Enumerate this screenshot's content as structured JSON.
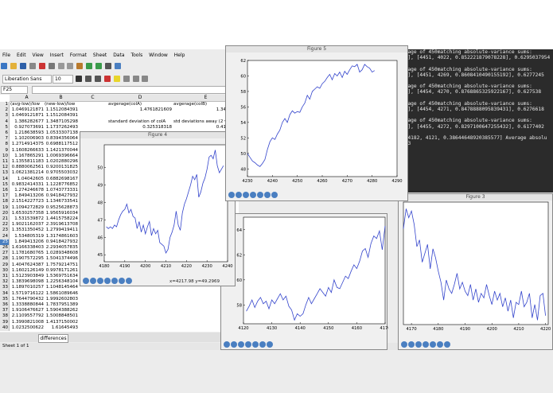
{
  "menu": [
    "File",
    "Edit",
    "View",
    "Insert",
    "Format",
    "Sheet",
    "Data",
    "Tools",
    "Window",
    "Help"
  ],
  "font": {
    "name": "Liberation Sans",
    "size": "10"
  },
  "namebox": "F25",
  "columns": [
    "A",
    "B",
    "C",
    "D",
    "E"
  ],
  "headers": {
    "a": "(avg-low)/low",
    "b": "(new-low)/low",
    "d": "avgerage(colA)",
    "e": "avgerage(colB)"
  },
  "stats": {
    "avgA": "1.4761821609",
    "avgB": "1.341899",
    "sd_label": "standard deviation of colA",
    "sd_away_label": "std deviations away (2 va",
    "sd_value": "0.325318318",
    "sd_away_value": "0.412772"
  },
  "rows": [
    [
      "1.0469121871",
      "1.1512084391"
    ],
    [
      "1.0469121871",
      "1.1512084391"
    ],
    [
      "1.386282677",
      "1.3487105298"
    ],
    [
      "0.927073691",
      "1.1737262493"
    ],
    [
      "1.218638593",
      "1.0533307138"
    ],
    [
      "1.102006903",
      "0.8394356064"
    ],
    [
      "1.2714914375",
      "0.6988117512"
    ],
    [
      "1.1608266633",
      "1.1421370044"
    ],
    [
      "1.167865291",
      "1.0069396664"
    ],
    [
      "1.1355811183",
      "1.0202880296"
    ],
    [
      "0.8880062561",
      "0.9200131825"
    ],
    [
      "1.0621381214",
      "0.9705503032"
    ],
    [
      "1.04042605",
      "0.6882698167"
    ],
    [
      "0.9832414331",
      "1.1228776852"
    ],
    [
      "1.274246678",
      "1.0743773331"
    ],
    [
      "1.849413206",
      "0.9418427932"
    ],
    [
      "2.1514227723",
      "1.1346733541"
    ],
    [
      "1.1094272829",
      "0.9525628873"
    ],
    [
      "1.6530257358",
      "1.9565916034"
    ],
    [
      "1.531539872",
      "1.4415758224"
    ],
    [
      "1.9021162037",
      "2.3919613708"
    ],
    [
      "1.3531350452",
      "1.2799419411"
    ],
    [
      "1.534805319",
      "1.3174861603"
    ],
    [
      "1.849413206",
      "0.9418427932"
    ],
    [
      "1.6166338403",
      "2.2934057835"
    ],
    [
      "1.1781680765",
      "1.0289348608"
    ],
    [
      "1.1907572295",
      "1.5041374496"
    ],
    [
      "1.4047624387",
      "1.7579214751"
    ],
    [
      "1.1602126149",
      "0.9978171261"
    ],
    [
      "1.5123903849",
      "1.5369751634"
    ],
    [
      "1.3839698098",
      "1.2256348104"
    ],
    [
      "1.1897010257",
      "1.1048145464"
    ],
    [
      "1.5719716122",
      "1.5861089646"
    ],
    [
      "1.7644790432",
      "1.9992602803"
    ],
    [
      "1.3338880844",
      "1.7837951389"
    ],
    [
      "1.9106476627",
      "1.5904388262"
    ],
    [
      "2.1109557792",
      "1.5008848501"
    ],
    [
      "1.3990821008",
      "1.4137150002"
    ],
    [
      "1.0232500622",
      "1.61645493"
    ]
  ],
  "sheet": {
    "tab": "differences",
    "status": "Sheet 1 of 1"
  },
  "terminal": [
    "erage of 450matching absolute-variance sums:",
    "46], [4451, 4022, 0.852221879078228], 0.6295037954",
    "",
    "erage of 450matching absolute-variance sums:",
    "73], [4451, 4269, 0.8608410490155192], 0.6277245",
    "",
    "erage of 450matching absolute-variance sums:",
    "73], [4454, 4270, 0.8768865325922167], 0.627538",
    "",
    "erage of 450matching absolute-variance sums:",
    "57], [4454, 4271, 0.8478888095839431], 0.6276618",
    "",
    "erage of 450matching absolute-variance sums:",
    "38], [4455, 4272, 0.8297100647255432], 0.6177402",
    "",
    " [4182, 4121, 0.38644648920385577] Average absolu",
    "863"
  ],
  "fig5": {
    "title": "Figure 5",
    "xticks": [
      "4230",
      "4240",
      "4250",
      "4260",
      "4270",
      "4280",
      "4290"
    ],
    "yticks": [
      "62",
      "60",
      "58",
      "56",
      "54",
      "52",
      "50",
      "48"
    ]
  },
  "figmid": {
    "title": "Figure 4",
    "xticks": [
      "4180",
      "4190",
      "4200",
      "4210",
      "4220",
      "4230",
      "4240"
    ],
    "yticks": [
      "50",
      "49",
      "48",
      "47",
      "46",
      "45"
    ],
    "coords": "x=4217.98    y=49.2969"
  },
  "figbl": {
    "xticks": [
      "4120",
      "4130",
      "4140",
      "4150",
      "4160",
      "4170"
    ],
    "yticks": [
      "64",
      "62",
      "60",
      "58"
    ]
  },
  "figbr": {
    "title": "Figure 3",
    "xticks": [
      "4170",
      "4180",
      "4190",
      "4200",
      "4210",
      "4220"
    ]
  },
  "chart_data": [
    {
      "type": "line",
      "title": "Figure 5",
      "xlim": [
        4230,
        4290
      ],
      "ylim": [
        47,
        62
      ],
      "x": [
        4230,
        4231,
        4232,
        4233,
        4234,
        4235,
        4236,
        4237,
        4238,
        4239,
        4240,
        4241,
        4242,
        4243,
        4244,
        4245,
        4246,
        4247,
        4248,
        4249,
        4250,
        4251,
        4252,
        4253,
        4254,
        4255,
        4256,
        4257,
        4258,
        4259,
        4260,
        4261,
        4262,
        4263,
        4264,
        4265,
        4266,
        4267,
        4268,
        4269,
        4270,
        4271,
        4272,
        4273,
        4274,
        4275,
        4276,
        4277,
        4278,
        4279,
        4280,
        4281
      ],
      "y": [
        50,
        49.5,
        49,
        48.8,
        48.5,
        48.3,
        48.7,
        49.2,
        50.5,
        51.5,
        52,
        51.8,
        52.5,
        53,
        54,
        54.5,
        54,
        55,
        55.5,
        55.2,
        55.4,
        55.3,
        56,
        56.5,
        57.5,
        57,
        58,
        58.3,
        58.6,
        58.4,
        59,
        59.3,
        59.8,
        60.2,
        59.5,
        60.3,
        60,
        60.5,
        59.8,
        60.6,
        60.2,
        60.8,
        61.3,
        61.2,
        61.5,
        60.5,
        60.8,
        61.5,
        61.2,
        61,
        60.5,
        60.7
      ]
    },
    {
      "type": "line",
      "title": "Figure 4",
      "xlim": [
        4180,
        4240
      ],
      "ylim": [
        44.6,
        51.3
      ],
      "x": [
        4181,
        4182,
        4183,
        4184,
        4185,
        4186,
        4187,
        4188,
        4189,
        4190,
        4191,
        4192,
        4193,
        4194,
        4195,
        4196,
        4197,
        4198,
        4199,
        4200,
        4201,
        4202,
        4203,
        4204,
        4205,
        4206,
        4207,
        4208,
        4209,
        4210,
        4211,
        4212,
        4213,
        4214,
        4215,
        4216,
        4217,
        4218,
        4219,
        4220,
        4221,
        4222,
        4223,
        4224,
        4225,
        4226,
        4227,
        4228,
        4229,
        4230,
        4231,
        4232,
        4233,
        4234,
        4235,
        4236,
        4237,
        4238
      ],
      "y": [
        46.6,
        46.5,
        46.6,
        46.5,
        46.7,
        46.6,
        47,
        47.3,
        47.5,
        47.6,
        47.9,
        47.4,
        47.6,
        47.2,
        47.1,
        46.5,
        46.9,
        46.3,
        46.7,
        46.2,
        46.6,
        46.9,
        46.1,
        46.5,
        46.2,
        46.4,
        45.7,
        45.6,
        45.5,
        45.1,
        45.3,
        46,
        46.3,
        46.7,
        47.5,
        46.7,
        46.4,
        47.4,
        47.9,
        48.2,
        48.6,
        49,
        49.5,
        49.3,
        49.6,
        48.3,
        48.6,
        49.1,
        49.4,
        49.9,
        50.6,
        50.7,
        50.5,
        51,
        50.1,
        49.7,
        49.9,
        50.1
      ]
    },
    {
      "type": "line",
      "xlim": [
        4120,
        4170
      ],
      "ylim": [
        56.5,
        65
      ],
      "x": [
        4121,
        4122,
        4123,
        4124,
        4125,
        4126,
        4127,
        4128,
        4129,
        4130,
        4131,
        4132,
        4133,
        4134,
        4135,
        4136,
        4137,
        4138,
        4139,
        4140,
        4141,
        4142,
        4143,
        4144,
        4145,
        4146,
        4147,
        4148,
        4149,
        4150,
        4151,
        4152,
        4153,
        4154,
        4155,
        4156,
        4157,
        4158,
        4159,
        4160,
        4161,
        4162,
        4163,
        4164,
        4165,
        4166,
        4167,
        4168,
        4169,
        4170
      ],
      "y": [
        57.5,
        57.9,
        58.4,
        57.8,
        58.3,
        58.6,
        58.1,
        58.3,
        57.7,
        58.4,
        58.1,
        58.5,
        58.9,
        58.4,
        58.7,
        57.9,
        57.6,
        56.8,
        57.3,
        57.1,
        57.3,
        58,
        58.6,
        58.1,
        58.5,
        58.9,
        59.3,
        59,
        58.7,
        59.4,
        59,
        60,
        59.4,
        59.3,
        59.8,
        60.3,
        60.1,
        60.7,
        61.2,
        60.9,
        61.5,
        62.3,
        62.5,
        61.8,
        62.9,
        63.5,
        63.3,
        63.9,
        62.4,
        64.3
      ]
    },
    {
      "type": "line",
      "title": "Figure 3",
      "xlim": [
        4167,
        4221
      ],
      "ylim": [
        61,
        66.5
      ],
      "x": [
        4167,
        4168,
        4169,
        4170,
        4171,
        4172,
        4173,
        4174,
        4175,
        4176,
        4177,
        4178,
        4179,
        4180,
        4181,
        4182,
        4183,
        4184,
        4185,
        4186,
        4187,
        4188,
        4189,
        4190,
        4191,
        4192,
        4193,
        4194,
        4195,
        4196,
        4197,
        4198,
        4199,
        4200,
        4201,
        4202,
        4203,
        4204,
        4205,
        4206,
        4207,
        4208,
        4209,
        4210,
        4211,
        4212,
        4213,
        4214,
        4215,
        4216,
        4217,
        4218,
        4219,
        4220
      ],
      "y": [
        65.3,
        66.2,
        65.8,
        66.1,
        65.5,
        64.5,
        64.8,
        63.8,
        64.2,
        64.6,
        63.5,
        64.4,
        64,
        63.4,
        62.9,
        62.1,
        63,
        62.6,
        62.4,
        62.8,
        63.3,
        62.6,
        62.9,
        62.5,
        62.3,
        62.8,
        62.1,
        62.6,
        62,
        62.4,
        62.2,
        62.8,
        62.3,
        61.9,
        62.5,
        62.1,
        62.4,
        61.8,
        62.2,
        61.6,
        62.1,
        61.3,
        62,
        61.9,
        62.5,
        61.8,
        62,
        62.4,
        61.3,
        61.9,
        61.2,
        62.3,
        62.4,
        61.4
      ]
    }
  ]
}
